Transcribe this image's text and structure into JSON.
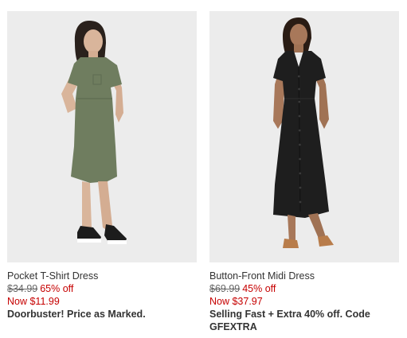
{
  "products": [
    {
      "name": "Pocket T-Shirt Dress",
      "original_price": "$34.99",
      "discount": "65% off",
      "now_price": "Now $11.99",
      "promo": "Doorbuster! Price as Marked.",
      "dress_color": "#6f7d5f",
      "image_icon": "model-in-olive-tshirt-dress"
    },
    {
      "name": "Button-Front Midi Dress",
      "original_price": "$69.99",
      "discount": "45% off",
      "now_price": "Now $37.97",
      "promo": "Selling Fast + Extra 40% off. Code GFEXTRA",
      "dress_color": "#1e1e1e",
      "image_icon": "model-in-black-midi-dress"
    }
  ],
  "colors": {
    "sale_red": "#c60000",
    "text": "#333333",
    "strikethrough": "#666666",
    "image_background": "#ededed"
  }
}
